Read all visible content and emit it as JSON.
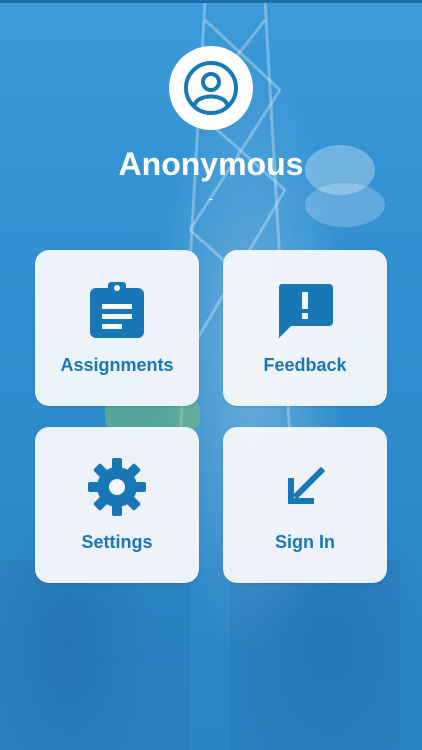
{
  "profile": {
    "name": "Anonymous",
    "subtitle": "-"
  },
  "menu": [
    {
      "label": "Assignments",
      "icon": "clipboard-icon"
    },
    {
      "label": "Feedback",
      "icon": "feedback-icon"
    },
    {
      "label": "Settings",
      "icon": "gear-icon"
    },
    {
      "label": "Sign In",
      "icon": "arrow-down-left-icon"
    }
  ],
  "colors": {
    "accent": "#1877b5",
    "background": "#2f8fd0",
    "tile": "#f5f7fa"
  }
}
